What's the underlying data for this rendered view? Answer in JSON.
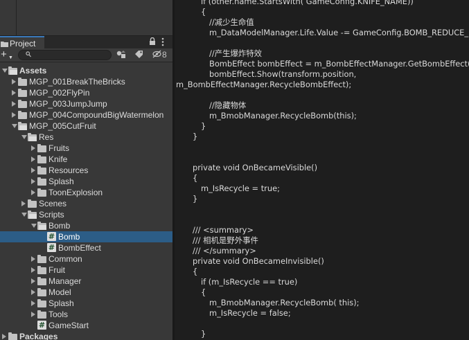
{
  "project_panel": {
    "tab_label": "Project",
    "lock_icon": "lock-icon",
    "menu_icon": "kebab-menu-icon",
    "add_label": "+",
    "search_placeholder": "",
    "hidden_packages_count": "8"
  },
  "tree": [
    {
      "label": "Assets",
      "icon": "folder-open",
      "expanded": true,
      "depth": 0
    },
    {
      "label": "MGP_001BreakTheBricks",
      "icon": "folder",
      "expanded": false,
      "depth": 1
    },
    {
      "label": "MGP_002FlyPin",
      "icon": "folder",
      "expanded": false,
      "depth": 1
    },
    {
      "label": "MGP_003JumpJump",
      "icon": "folder",
      "expanded": false,
      "depth": 1
    },
    {
      "label": "MGP_004CompoundBigWatermelon",
      "icon": "folder",
      "expanded": false,
      "depth": 1
    },
    {
      "label": "MGP_005CutFruit",
      "icon": "folder-open",
      "expanded": true,
      "depth": 1
    },
    {
      "label": "Res",
      "icon": "folder-open",
      "expanded": true,
      "depth": 2
    },
    {
      "label": "Fruits",
      "icon": "folder",
      "expanded": false,
      "depth": 3
    },
    {
      "label": "Knife",
      "icon": "folder",
      "expanded": false,
      "depth": 3
    },
    {
      "label": "Resources",
      "icon": "folder",
      "expanded": false,
      "depth": 3
    },
    {
      "label": "Splash",
      "icon": "folder",
      "expanded": false,
      "depth": 3
    },
    {
      "label": "ToonExplosion",
      "icon": "folder",
      "expanded": false,
      "depth": 3
    },
    {
      "label": "Scenes",
      "icon": "folder",
      "expanded": false,
      "depth": 2
    },
    {
      "label": "Scripts",
      "icon": "folder-open",
      "expanded": true,
      "depth": 2
    },
    {
      "label": "Bomb",
      "icon": "folder-open",
      "expanded": true,
      "depth": 3
    },
    {
      "label": "Bomb",
      "icon": "csharp-script",
      "expanded": null,
      "depth": 4,
      "selected": true
    },
    {
      "label": "BombEffect",
      "icon": "csharp-script",
      "expanded": null,
      "depth": 4
    },
    {
      "label": "Common",
      "icon": "folder",
      "expanded": false,
      "depth": 3
    },
    {
      "label": "Fruit",
      "icon": "folder",
      "expanded": false,
      "depth": 3
    },
    {
      "label": "Manager",
      "icon": "folder",
      "expanded": false,
      "depth": 3
    },
    {
      "label": "Model",
      "icon": "folder",
      "expanded": false,
      "depth": 3
    },
    {
      "label": "Splash",
      "icon": "folder",
      "expanded": false,
      "depth": 3
    },
    {
      "label": "Tools",
      "icon": "folder",
      "expanded": false,
      "depth": 3
    },
    {
      "label": "GameStart",
      "icon": "csharp-script",
      "expanded": null,
      "depth": 3
    },
    {
      "label": "Packages",
      "icon": "folder",
      "expanded": false,
      "depth": 0
    }
  ],
  "code_lines": [
    {
      "indent": 2,
      "text": "if (other.name.StartsWith( GameConfig.KNIFE_NAME))"
    },
    {
      "indent": 2,
      "text": "{"
    },
    {
      "indent": 3,
      "text": "//减少生命值"
    },
    {
      "indent": 3,
      "text": "m_DataModelManager.Life.Value -= GameConfig.BOMB_REDUCE_"
    },
    {
      "indent": 3,
      "text": ""
    },
    {
      "indent": 3,
      "text": "//产生爆炸特效"
    },
    {
      "indent": 3,
      "text": "BombEffect bombEffect = m_BombEffectManager.GetBombEffect();"
    },
    {
      "indent": 3,
      "text": "bombEffect.Show(transform.position,"
    },
    {
      "indent": 0,
      "text": "m_BombEffectManager.RecycleBombEffect);"
    },
    {
      "indent": 3,
      "text": ""
    },
    {
      "indent": 3,
      "text": "//隐藏物体"
    },
    {
      "indent": 3,
      "text": "m_BmobManager.RecycleBomb(this);"
    },
    {
      "indent": 2,
      "text": "}"
    },
    {
      "indent": 1,
      "text": "}"
    },
    {
      "indent": 1,
      "text": ""
    },
    {
      "indent": 1,
      "text": ""
    },
    {
      "indent": 1,
      "text": "private void OnBecameVisible()"
    },
    {
      "indent": 1,
      "text": "{"
    },
    {
      "indent": 2,
      "text": "m_IsRecycle = true;"
    },
    {
      "indent": 1,
      "text": "}"
    },
    {
      "indent": 1,
      "text": ""
    },
    {
      "indent": 1,
      "text": ""
    },
    {
      "indent": 1,
      "text": "/// <summary>"
    },
    {
      "indent": 1,
      "text": "/// 相机是野外事件"
    },
    {
      "indent": 1,
      "text": "/// </summary>"
    },
    {
      "indent": 1,
      "text": "private void OnBecameInvisible()"
    },
    {
      "indent": 1,
      "text": "{"
    },
    {
      "indent": 2,
      "text": "if (m_IsRecycle == true)"
    },
    {
      "indent": 2,
      "text": "{"
    },
    {
      "indent": 3,
      "text": "m_BmobManager.RecycleBomb( this);"
    },
    {
      "indent": 3,
      "text": "m_IsRecycle = false;"
    },
    {
      "indent": 2,
      "text": ""
    },
    {
      "indent": 2,
      "text": "}"
    }
  ],
  "colors": {
    "panel_bg": "#383838",
    "editor_bg": "#1e1e1e",
    "selection": "#2c5d87",
    "tab_accent": "#3a79bb"
  }
}
